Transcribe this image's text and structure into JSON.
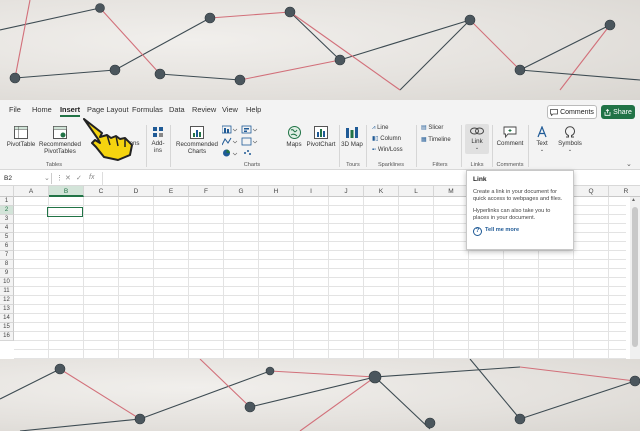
{
  "menu": {
    "tabs": [
      "File",
      "Home",
      "Insert",
      "Page Layout",
      "Formulas",
      "Data",
      "Review",
      "View",
      "Help"
    ],
    "active_tab": "Insert",
    "comments_label": "Comments",
    "share_label": "Share"
  },
  "ribbon": {
    "pivottable": "PivotTable",
    "recommended_pivottables": "Recommended PivotTables",
    "tables_group": "Tables",
    "illustrations_partial": "tions",
    "addins": "Add-ins",
    "recommended_charts": "Recommended Charts",
    "maps": "Maps",
    "pivotchart": "PivotChart",
    "charts_group": "Charts",
    "map3d": "3D Map",
    "tours_group": "Tours",
    "line": "Line",
    "column": "Column",
    "winloss": "Win/Loss",
    "sparklines_group": "Sparklines",
    "slicer": "Slicer",
    "timeline": "Timeline",
    "filters_group": "Filters",
    "link": "Link",
    "links_group": "Links",
    "comment": "Comment",
    "comments_group": "Comments",
    "text": "Text",
    "symbols": "Symbols"
  },
  "formula_bar": {
    "name_box": "B2",
    "fx": "fx"
  },
  "sheet": {
    "columns": [
      "A",
      "B",
      "C",
      "D",
      "E",
      "F",
      "G",
      "H",
      "I",
      "J",
      "K",
      "L",
      "M",
      "N",
      "O",
      "P",
      "Q",
      "R"
    ],
    "rows": [
      "1",
      "2",
      "3",
      "4",
      "5",
      "6",
      "7",
      "8",
      "9",
      "10",
      "11",
      "12",
      "13",
      "14",
      "15",
      "16"
    ],
    "selected_cell": "B2"
  },
  "tooltip": {
    "title": "Link",
    "line1": "Create a link in your document for quick access to webpages and files.",
    "line2": "Hyperlinks can also take you to places in your document.",
    "more": "Tell me more"
  },
  "colors": {
    "accent": "#217346",
    "tooltip_link": "#1f5a96",
    "cursor_yellow": "#f5d40f"
  }
}
